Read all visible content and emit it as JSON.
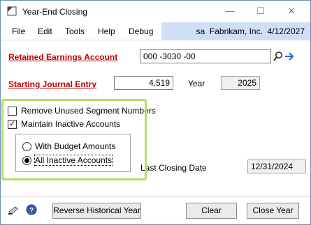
{
  "window": {
    "title": "Year-End Closing"
  },
  "menu": {
    "items": [
      "File",
      "Edit",
      "Tools",
      "Help",
      "Debug"
    ],
    "user": "sa",
    "company": "Fabrikam, Inc.",
    "date": "4/12/2027"
  },
  "form": {
    "retained_earnings_label": "Retained Earnings Account",
    "retained_earnings_value": "000 -3030 -00",
    "starting_je_label": "Starting Journal Entry",
    "starting_je_value": "4,519",
    "year_label": "Year",
    "year_value": "2025",
    "remove_unused_label": "Remove Unused Segment Numbers",
    "remove_unused_checked": false,
    "maintain_inactive_label": "Maintain Inactive Accounts",
    "maintain_inactive_checked": true,
    "radio_budget_label": "With Budget Amounts",
    "radio_all_label": "All Inactive Accounts",
    "radio_selected": "all",
    "last_closing_label": "Last Closing Date",
    "last_closing_value": "12/31/2024"
  },
  "footer": {
    "reverse_label": "Reverse Historical Year",
    "clear_label": "Clear",
    "close_year_label": "Close Year"
  },
  "icons": {
    "app": "app-window-icon",
    "lookup": "magnifier-icon",
    "expansion": "blue-arrow-icon",
    "note": "note-icon",
    "help": "help-icon"
  },
  "colors": {
    "required_label": "#c00000",
    "highlight_border": "#b6dd6b",
    "menu_right_bg": "#cfe0f6"
  }
}
